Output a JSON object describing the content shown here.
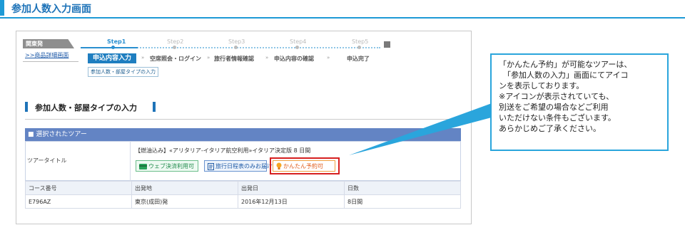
{
  "heading": {
    "title": "参加人数入力画面"
  },
  "top": {
    "region_tab": "関東発",
    "detail_link": ">>商品詳細画面"
  },
  "steps": [
    "Step1",
    "Step2",
    "Step3",
    "Step4",
    "Step5"
  ],
  "nav": {
    "active": "申込内容入力",
    "items": [
      "空席照会・ログイン",
      "旅行者情報確認",
      "申込内容の確認",
      "申込完了"
    ],
    "arrow": "»",
    "sub": "参加人数・部屋タイプの入力"
  },
  "section": {
    "title": "参加人数・部屋タイプの入力"
  },
  "tour": {
    "header": "■ 選択されたツアー",
    "label": "ツアータイトル",
    "title": "【燃油込み】«アリタリア-イタリア航空利用»イタリア決定版 8 日間",
    "badges": {
      "web": "ウェブ決済利用可",
      "schedule": "旅行日程表のみお届け",
      "easy": "かんたん予約可"
    }
  },
  "table": {
    "headers": [
      "コース番号",
      "出発地",
      "出発日",
      "日数"
    ],
    "row": [
      "E796AZ",
      "東京(成田)発",
      "2016年12月13日",
      "8日間"
    ]
  },
  "callout": {
    "lines": [
      "「かんたん予約」が可能なツアーは、",
      "「参加人数の入力」画面にてアイコ",
      "ンを表示しております。",
      "※アイコンが表示されていても、",
      "別送をご希望の場合などご利用",
      "いただけない条件もございます。",
      "あらかじめご了承ください。"
    ]
  },
  "colors": {
    "accent": "#1e9ad6",
    "highlight": "#d62020",
    "tour_header": "#6384c4"
  }
}
